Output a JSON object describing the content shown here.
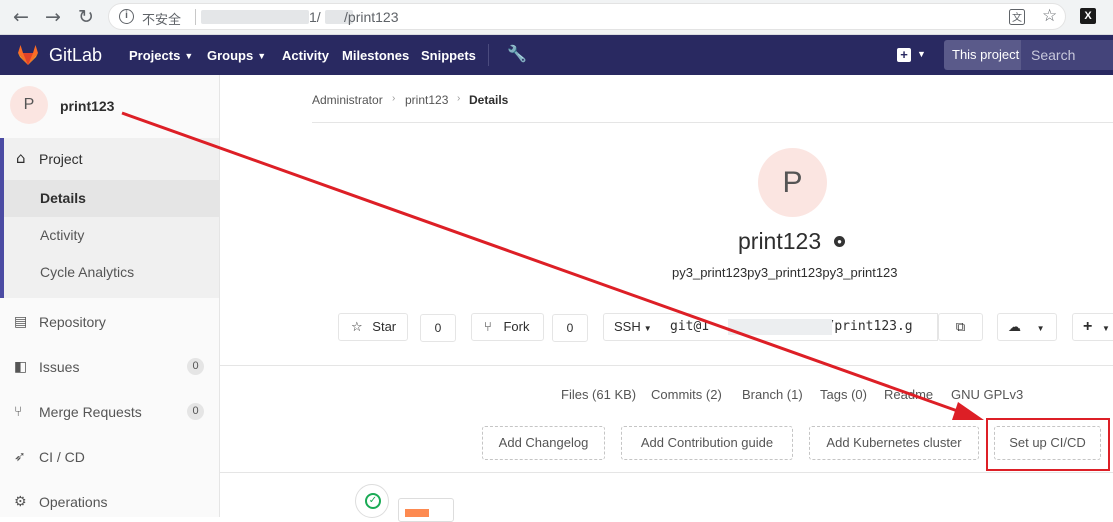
{
  "browser": {
    "back": "←",
    "forward": "→",
    "reload": "↻",
    "insecure_label": "不安全",
    "url_path": "1/      /print123",
    "translate_icon": "translate-icon",
    "star_icon": "☆",
    "extension": "X"
  },
  "gitlab_nav": {
    "brand": "GitLab",
    "menu": [
      {
        "label": "Projects",
        "caret": true
      },
      {
        "label": "Groups",
        "caret": true
      },
      {
        "label": "Activity",
        "caret": false
      },
      {
        "label": "Milestones",
        "caret": false
      },
      {
        "label": "Snippets",
        "caret": false
      }
    ],
    "scope_label": "This project",
    "search_placeholder": "Search",
    "colors": {
      "navbar": "#292961",
      "logo": "#fc6d26"
    }
  },
  "sidebar": {
    "avatar_letter": "P",
    "project_name": "print123",
    "section_label": "Project",
    "sub_items": [
      {
        "label": "Details",
        "active": true
      },
      {
        "label": "Activity",
        "active": false
      },
      {
        "label": "Cycle Analytics",
        "active": false
      }
    ],
    "items": [
      {
        "label": "Repository",
        "icon": "📄",
        "badge": null
      },
      {
        "label": "Issues",
        "icon": "▯",
        "badge": "0"
      },
      {
        "label": "Merge Requests",
        "icon": "⑂",
        "badge": "0"
      },
      {
        "label": "CI / CD",
        "icon": "🚀",
        "badge": null
      },
      {
        "label": "Operations",
        "icon": "⚙",
        "badge": null
      }
    ]
  },
  "breadcrumb": {
    "items": [
      "Administrator",
      "print123",
      "Details"
    ]
  },
  "project": {
    "avatar_letter": "P",
    "title": "print123",
    "description": "py3_print123py3_print123py3_print123"
  },
  "actions": {
    "star_label": "Star",
    "star_count": "0",
    "fork_label": "Fork",
    "fork_count": "0",
    "protocol": "SSH",
    "clone_url": "git@1              :/print123.g"
  },
  "stats": [
    "Files (61 KB)",
    "Commits (2)",
    "Branch (1)",
    "Tags (0)",
    "Readme",
    "GNU GPLv3"
  ],
  "setup_buttons": [
    "Add Changelog",
    "Add Contribution guide",
    "Add Kubernetes cluster",
    "Set up CI/CD"
  ],
  "annotation": {
    "color": "#dd1f26"
  }
}
